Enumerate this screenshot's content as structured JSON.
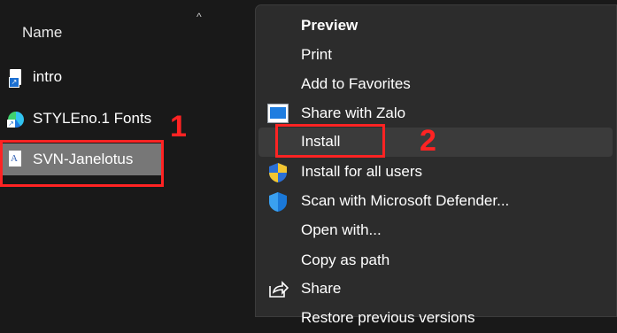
{
  "explorer": {
    "column_header": "Name",
    "sort_glyph": "^",
    "files": [
      {
        "name": "intro",
        "icon": "shortcut-file-icon"
      },
      {
        "name": "STYLEno.1 Fonts",
        "icon": "edge-shortcut-icon"
      },
      {
        "name": "SVN-Janelotus",
        "icon": "font-file-icon",
        "selected": true
      }
    ]
  },
  "annotations": {
    "step1": "1",
    "step2": "2",
    "color": "#ff2323"
  },
  "context_menu": {
    "items": [
      {
        "label": "Preview",
        "bold": true
      },
      {
        "label": "Print"
      },
      {
        "label": "Add to Favorites"
      },
      {
        "label": "Share with Zalo",
        "icon": "zalo-icon"
      },
      {
        "label": "Install",
        "hovered": true
      },
      {
        "label": "Install for all users",
        "icon": "uac-shield-icon"
      },
      {
        "label": "Scan with Microsoft Defender...",
        "icon": "defender-shield-icon"
      },
      {
        "label": "Open with..."
      },
      {
        "label": "Copy as path"
      },
      {
        "label": "Share",
        "icon": "share-icon"
      },
      {
        "label": "Restore previous versions"
      }
    ]
  },
  "colors": {
    "background": "#191919",
    "menu_background": "#2c2c2c",
    "selection": "#777777",
    "hover": "#3b3b3b"
  }
}
